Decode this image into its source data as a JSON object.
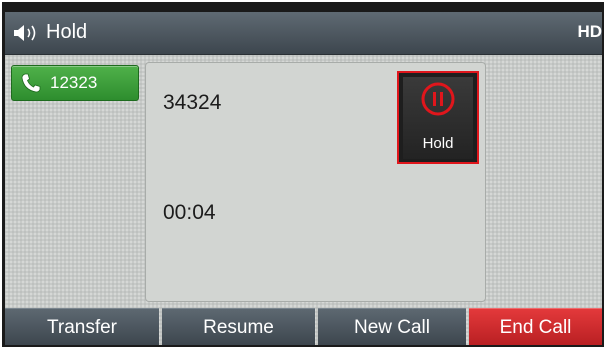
{
  "titlebar": {
    "icon": "speaker-icon",
    "title": "Hold",
    "hd_badge": "HD"
  },
  "line": {
    "icon": "phone-icon",
    "label": "12323",
    "color": "#3aa23a"
  },
  "call": {
    "callee": "34324",
    "duration": "00:04",
    "status_icon": "pause-icon",
    "status_label": "Hold",
    "highlight_color": "#e0161c"
  },
  "softkeys": [
    {
      "label": "Transfer"
    },
    {
      "label": "Resume"
    },
    {
      "label": "New Call"
    },
    {
      "label": "End Call",
      "color": "#d62d30"
    }
  ]
}
